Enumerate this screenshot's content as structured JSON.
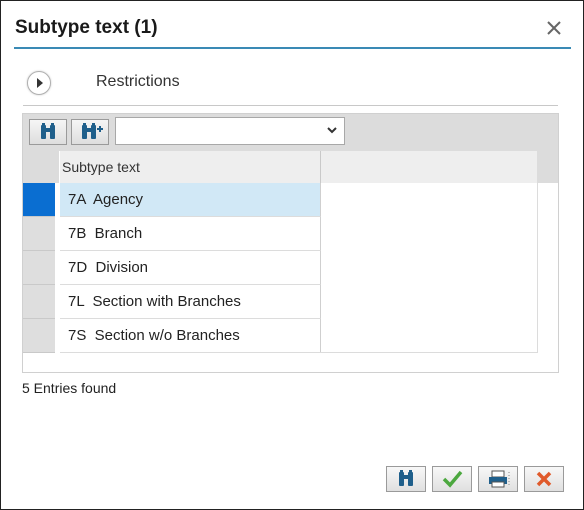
{
  "dialog": {
    "title": "Subtype text (1)",
    "close_icon": "close-icon"
  },
  "restrictions": {
    "label": "Restrictions",
    "expand_icon": "play-icon"
  },
  "toolbar": {
    "find_icon": "binoculars-icon",
    "find_next_icon": "binoculars-plus-icon",
    "dropdown_value": ""
  },
  "table": {
    "column_header": "Subtype text",
    "rows": [
      {
        "text": "7A  Agency",
        "selected": true
      },
      {
        "text": "7B  Branch",
        "selected": false
      },
      {
        "text": "7D  Division",
        "selected": false
      },
      {
        "text": "7L  Section with Branches",
        "selected": false
      },
      {
        "text": "7S  Section w/o Branches",
        "selected": false
      }
    ]
  },
  "status": "5 Entries found",
  "footer": {
    "buttons": [
      "binoculars-icon",
      "checkmark-icon",
      "print-icon",
      "cancel-icon"
    ]
  },
  "colors": {
    "accent_rule": "#3a8ab5",
    "selected_row": "#d1e8f6",
    "selected_marker": "#0a6ed1",
    "check_green": "#4ca83f",
    "cancel_red": "#e05a2b"
  }
}
